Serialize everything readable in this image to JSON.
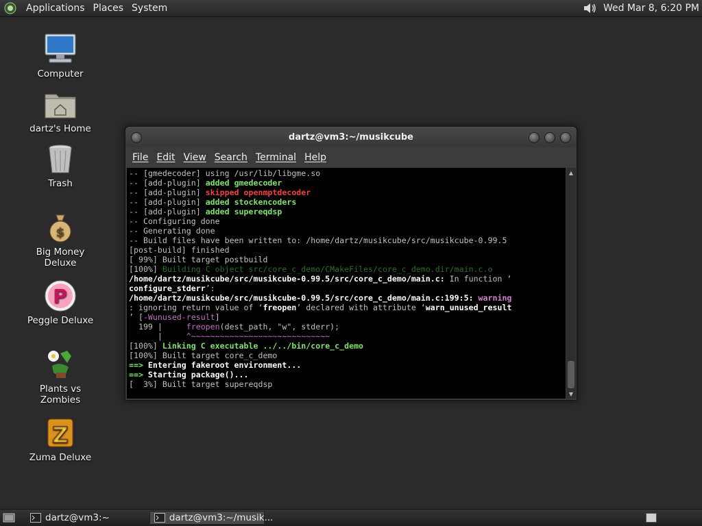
{
  "top_panel": {
    "menus": [
      "Applications",
      "Places",
      "System"
    ],
    "clock": "Wed Mar  8,  6:20 PM"
  },
  "desktop_icons": [
    {
      "label": "Computer",
      "icon": "computer-icon"
    },
    {
      "label": "dartz's Home",
      "icon": "home-folder-icon"
    },
    {
      "label": "Trash",
      "icon": "trash-icon"
    },
    {
      "label": "Big Money Deluxe",
      "icon": "money-bag-icon"
    },
    {
      "label": "Peggle Deluxe",
      "icon": "peggle-icon"
    },
    {
      "label": "Plants vs Zombies",
      "icon": "plants-icon"
    },
    {
      "label": "Zuma Deluxe",
      "icon": "zuma-icon"
    }
  ],
  "terminal": {
    "title": "dartz@vm3:~/musikcube",
    "menu": [
      "File",
      "Edit",
      "View",
      "Search",
      "Terminal",
      "Help"
    ],
    "lines": [
      [
        [
          "-- [gmedecoder] using /usr/lib/libgme.so",
          "c-default"
        ]
      ],
      [
        [
          "-- [add-plugin] ",
          "c-default"
        ],
        [
          "added gmedecoder",
          "c-green"
        ]
      ],
      [
        [
          "-- [add-plugin] ",
          "c-default"
        ],
        [
          "skipped openmptdecoder",
          "c-red"
        ]
      ],
      [
        [
          "-- [add-plugin] ",
          "c-default"
        ],
        [
          "added stockencoders",
          "c-green"
        ]
      ],
      [
        [
          "-- [add-plugin] ",
          "c-default"
        ],
        [
          "added supereqdsp",
          "c-green"
        ]
      ],
      [
        [
          "-- Configuring done",
          "c-default"
        ]
      ],
      [
        [
          "-- Generating done",
          "c-default"
        ]
      ],
      [
        [
          "-- Build files have been written to: /home/dartz/musikcube/src/musikcube-0.99.5",
          "c-default"
        ]
      ],
      [
        [
          "[post-build] finished",
          "c-default"
        ]
      ],
      [
        [
          "[ 99%] Built target postbuild",
          "c-default"
        ]
      ],
      [
        [
          "[100%] ",
          "c-default"
        ],
        [
          "Building C object src/core_c_demo/CMakeFiles/core_c_demo.dir/main.c.o",
          "c-dkgreen"
        ]
      ],
      [
        [
          "/home/dartz/musikcube/src/musikcube-0.99.5/src/core_c_demo/main.c:",
          "c-bold"
        ],
        [
          " In function ‘",
          "c-default"
        ]
      ],
      [
        [
          "configure_stderr",
          "c-bold"
        ],
        [
          "’:",
          "c-default"
        ]
      ],
      [
        [
          "/home/dartz/musikcube/src/musikcube-0.99.5/src/core_c_demo/main.c:199:5:",
          "c-bold"
        ],
        [
          " ",
          "c-default"
        ],
        [
          "warning",
          "c-mag-b"
        ]
      ],
      [
        [
          ": ignoring return value of ‘",
          "c-default"
        ],
        [
          "freopen",
          "c-bold"
        ],
        [
          "’ declared with attribute ‘",
          "c-default"
        ],
        [
          "warn_unused_result",
          "c-bold"
        ]
      ],
      [
        [
          "’ [",
          "c-default"
        ],
        [
          "-Wunused-result",
          "c-magenta"
        ],
        [
          "]",
          "c-default"
        ]
      ],
      [
        [
          "  199 |     ",
          "c-default"
        ],
        [
          "freopen",
          "c-magenta"
        ],
        [
          "(dest_path, \"w\", stderr);",
          "c-default"
        ]
      ],
      [
        [
          "      |     ",
          "c-default"
        ],
        [
          "^~~~~~~~~~~~~~~~~~~~~~~~~~~~~~",
          "c-magenta"
        ]
      ],
      [
        [
          "[100%] ",
          "c-default"
        ],
        [
          "Linking C executable ../../bin/core_c_demo",
          "c-green"
        ]
      ],
      [
        [
          "[100%] Built target core_c_demo",
          "c-default"
        ]
      ],
      [
        [
          "==> ",
          "c-arrow"
        ],
        [
          "Entering fakeroot environment...",
          "c-bold"
        ]
      ],
      [
        [
          "==> ",
          "c-arrow"
        ],
        [
          "Starting package()...",
          "c-bold"
        ]
      ],
      [
        [
          "[  3%] Built target supereqdsp",
          "c-default"
        ]
      ]
    ]
  },
  "taskbar": {
    "tasks": [
      {
        "label": "dartz@vm3:~",
        "active": false
      },
      {
        "label": "dartz@vm3:~/musik...",
        "active": true
      }
    ]
  }
}
